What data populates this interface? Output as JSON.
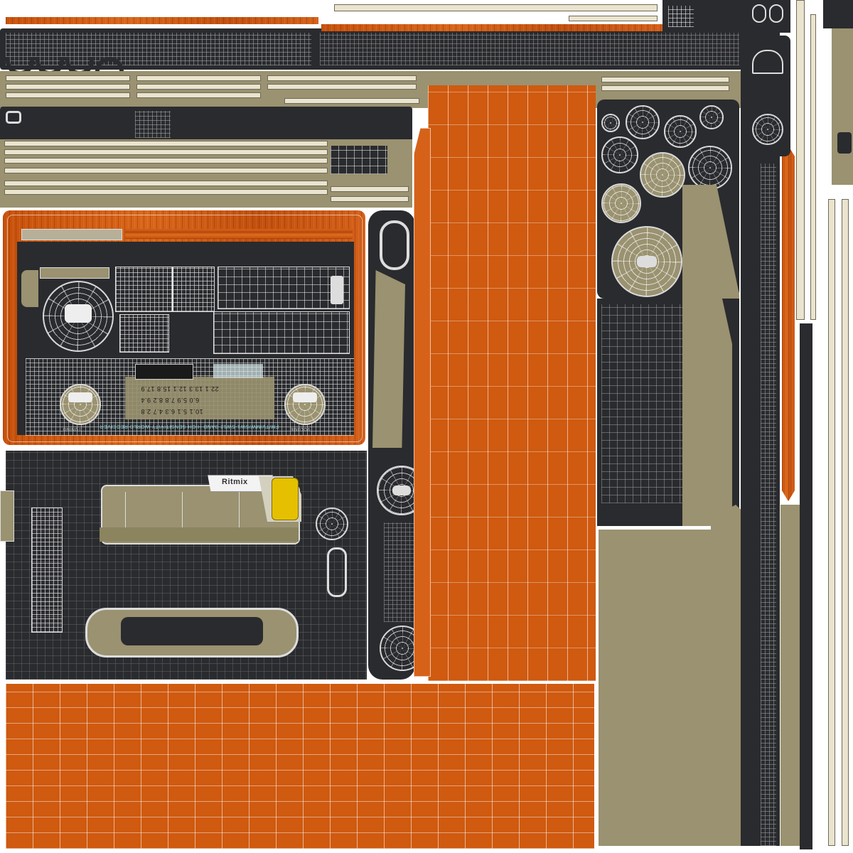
{
  "image": {
    "kind": "UV texture map with wireframe overlay",
    "colors": {
      "wood": "#cf5a10",
      "panel_dark": "#2a2b2e",
      "panel_khaki": "#9a9270",
      "strip_light": "#eae4cf",
      "wire": "#ffffff",
      "accent_yellow": "#e5c000"
    }
  },
  "labels": {
    "brand": "Ritmix",
    "tuning": "TUNING",
    "volume": "VOLUME",
    "receiver_title": "FM/TV/MW/SW1-SW12 BAND HIGH SENSITIVITY WORLD RECEIVER",
    "freq_row_1": "10.1  5.1  6.3  4.7  2.8",
    "freq_row_2": "6.0  5.9  7.8  8.2  9.4",
    "freq_row_3": "22.1  13.3  12.1  15.8  17.9"
  },
  "icons": [
    "speaker-grille-icon",
    "knob-icon",
    "dial-icon",
    "yellow-button-icon"
  ]
}
